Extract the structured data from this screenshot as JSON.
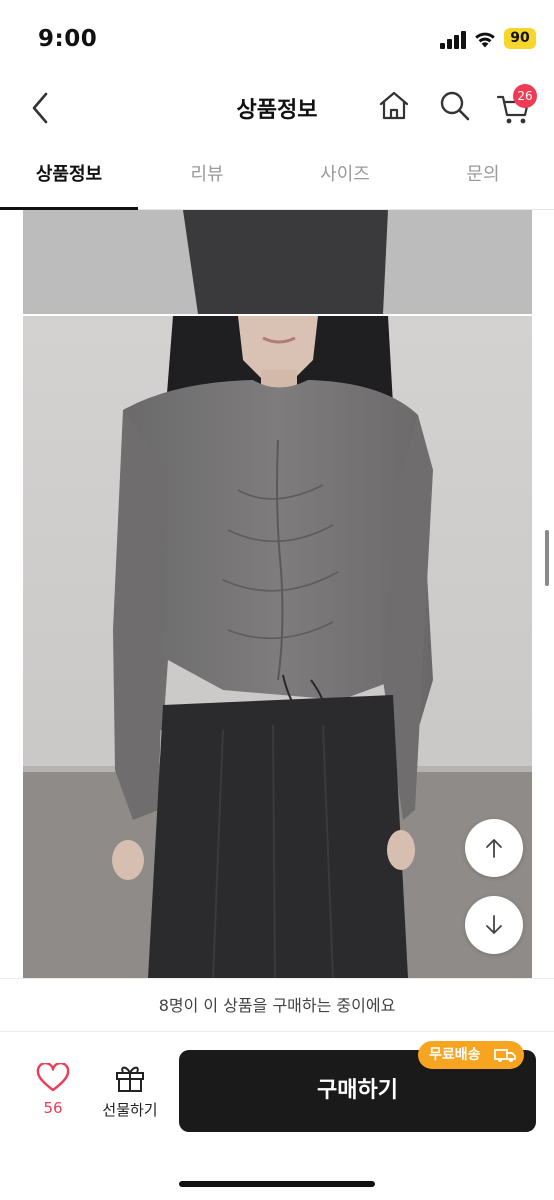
{
  "status_bar": {
    "time": "9:00",
    "battery": "90"
  },
  "nav": {
    "title": "상품정보",
    "cart_count": "26",
    "icons": [
      "back-icon",
      "home-icon",
      "search-icon",
      "cart-icon"
    ]
  },
  "tabs": [
    {
      "label": "상품정보",
      "active": true
    },
    {
      "label": "리뷰",
      "active": false
    },
    {
      "label": "사이즈",
      "active": false
    },
    {
      "label": "문의",
      "active": false
    }
  ],
  "scroll_buttons": {
    "up_icon": "arrow-up-icon",
    "down_icon": "arrow-down-icon"
  },
  "notice": "8명이 이 상품을 구매하는 중이에요",
  "bottom": {
    "like_count": "56",
    "gift_label": "선물하기",
    "buy_label": "구매하기",
    "free_shipping_badge": "무료배송"
  },
  "colors": {
    "accent_pink": "#ef3b54",
    "buy_button": "#1a1a1a",
    "badge_orange": "#f7a520",
    "battery_yellow": "#f7d52b"
  }
}
